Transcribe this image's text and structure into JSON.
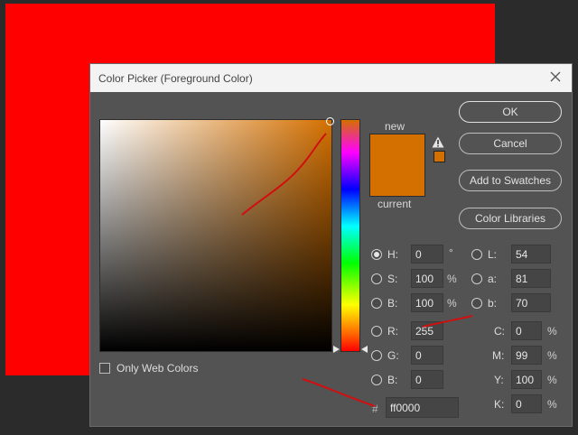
{
  "dialog": {
    "title": "Color Picker (Foreground Color)",
    "new_label": "new",
    "current_label": "current",
    "new_color": "#d47000",
    "current_color": "#d47000",
    "buttons": {
      "ok": "OK",
      "cancel": "Cancel",
      "add_to_swatches": "Add to Swatches",
      "color_libraries": "Color Libraries"
    },
    "only_web_colors": "Only Web Colors",
    "fields": {
      "h": {
        "label": "H:",
        "value": "0",
        "unit": "°"
      },
      "s": {
        "label": "S:",
        "value": "100",
        "unit": "%"
      },
      "b": {
        "label": "B:",
        "value": "100",
        "unit": "%"
      },
      "r": {
        "label": "R:",
        "value": "255"
      },
      "g": {
        "label": "G:",
        "value": "0"
      },
      "b2": {
        "label": "B:",
        "value": "0"
      },
      "l": {
        "label": "L:",
        "value": "54"
      },
      "a": {
        "label": "a:",
        "value": "81"
      },
      "lab_b": {
        "label": "b:",
        "value": "70"
      },
      "c": {
        "label": "C:",
        "value": "0",
        "unit": "%"
      },
      "m": {
        "label": "M:",
        "value": "99",
        "unit": "%"
      },
      "y": {
        "label": "Y:",
        "value": "100",
        "unit": "%"
      },
      "k": {
        "label": "K:",
        "value": "0",
        "unit": "%"
      },
      "hex": {
        "label": "#",
        "value": "ff0000"
      }
    }
  },
  "colors": {
    "document_canvas": "#ff0000",
    "dialog_bg": "#535353",
    "annotation": "#d01010"
  }
}
